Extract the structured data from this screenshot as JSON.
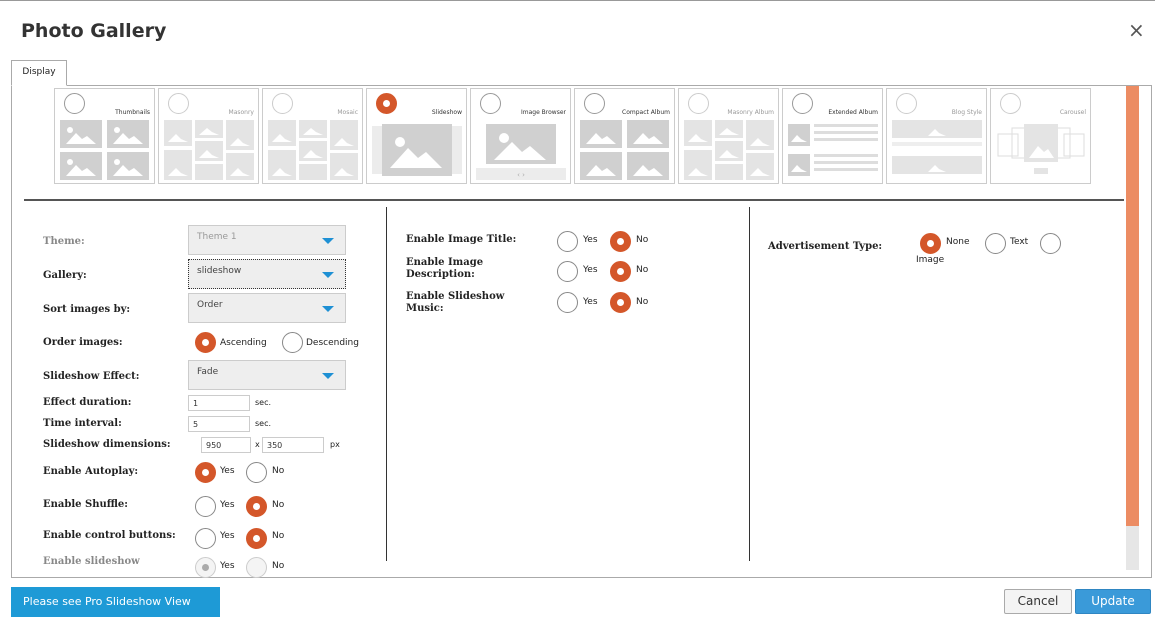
{
  "dialog": {
    "title": "Photo Gallery",
    "close_icon": "close-icon",
    "close_glyph": "×"
  },
  "tabs": [
    {
      "label": "Display",
      "active": true
    }
  ],
  "views": [
    {
      "label": "Thumbnails",
      "selected": false,
      "dimmed": false,
      "icon": "thumbnails-view-icon"
    },
    {
      "label": "Masonry",
      "selected": false,
      "dimmed": true,
      "icon": "masonry-view-icon"
    },
    {
      "label": "Mosaic",
      "selected": false,
      "dimmed": true,
      "icon": "mosaic-view-icon"
    },
    {
      "label": "Slideshow",
      "selected": true,
      "dimmed": false,
      "icon": "slideshow-view-icon"
    },
    {
      "label": "Image Browser",
      "selected": false,
      "dimmed": false,
      "icon": "image-browser-view-icon"
    },
    {
      "label": "Compact Album",
      "selected": false,
      "dimmed": false,
      "icon": "compact-album-view-icon"
    },
    {
      "label": "Masonry Album",
      "selected": false,
      "dimmed": true,
      "icon": "masonry-album-view-icon"
    },
    {
      "label": "Extended Album",
      "selected": false,
      "dimmed": false,
      "icon": "extended-album-view-icon"
    },
    {
      "label": "Blog Style",
      "selected": false,
      "dimmed": true,
      "icon": "blog-style-view-icon"
    },
    {
      "label": "Carousel",
      "selected": false,
      "dimmed": true,
      "icon": "carousel-view-icon"
    }
  ],
  "left": {
    "theme": {
      "label": "Theme:",
      "value": "Theme 1"
    },
    "gallery": {
      "label": "Gallery:",
      "value": "slideshow"
    },
    "sort": {
      "label": "Sort images by:",
      "value": "Order"
    },
    "order": {
      "label": "Order images:",
      "opt1": "Ascending",
      "opt2": "Descending",
      "selected": "Ascending"
    },
    "effect": {
      "label": "Slideshow Effect:",
      "value": "Fade"
    },
    "duration": {
      "label": "Effect duration:",
      "value": "1",
      "unit": "sec."
    },
    "interval": {
      "label": "Time interval:",
      "value": "5",
      "unit": "sec."
    },
    "dimensions": {
      "label": "Slideshow dimensions:",
      "width": "950",
      "sep": "x",
      "height": "350",
      "unit": "px"
    },
    "autoplay": {
      "label": "Enable Autoplay:",
      "yes": "Yes",
      "no": "No",
      "selected": "Yes"
    },
    "shuffle": {
      "label": "Enable Shuffle:",
      "yes": "Yes",
      "no": "No",
      "selected": "No"
    },
    "control": {
      "label": "Enable control buttons:",
      "yes": "Yes",
      "no": "No",
      "selected": "No"
    },
    "slideshow_filmstrip": {
      "label": "Enable slideshow",
      "yes": "Yes",
      "no": "No",
      "selected": "Yes"
    }
  },
  "middle": {
    "image_title": {
      "label": "Enable Image Title:",
      "yes": "Yes",
      "no": "No",
      "selected": "No"
    },
    "image_desc": {
      "label1": "Enable Image",
      "label2": "Description:",
      "yes": "Yes",
      "no": "No",
      "selected": "No"
    },
    "music": {
      "label1": "Enable Slideshow",
      "label2": "Music:",
      "yes": "Yes",
      "no": "No",
      "selected": "No"
    }
  },
  "right": {
    "ad": {
      "label": "Advertisement Type:",
      "opt1": "None",
      "opt2": "Text",
      "opt3": "Image",
      "selected": "None"
    }
  },
  "footer": {
    "pro_label": "Please see Pro Slideshow View",
    "cancel_label": "Cancel",
    "update_label": "Update"
  },
  "colors": {
    "accent": "#d4572a",
    "primary": "#1e9ad6",
    "scroll": "#ec8c63"
  }
}
